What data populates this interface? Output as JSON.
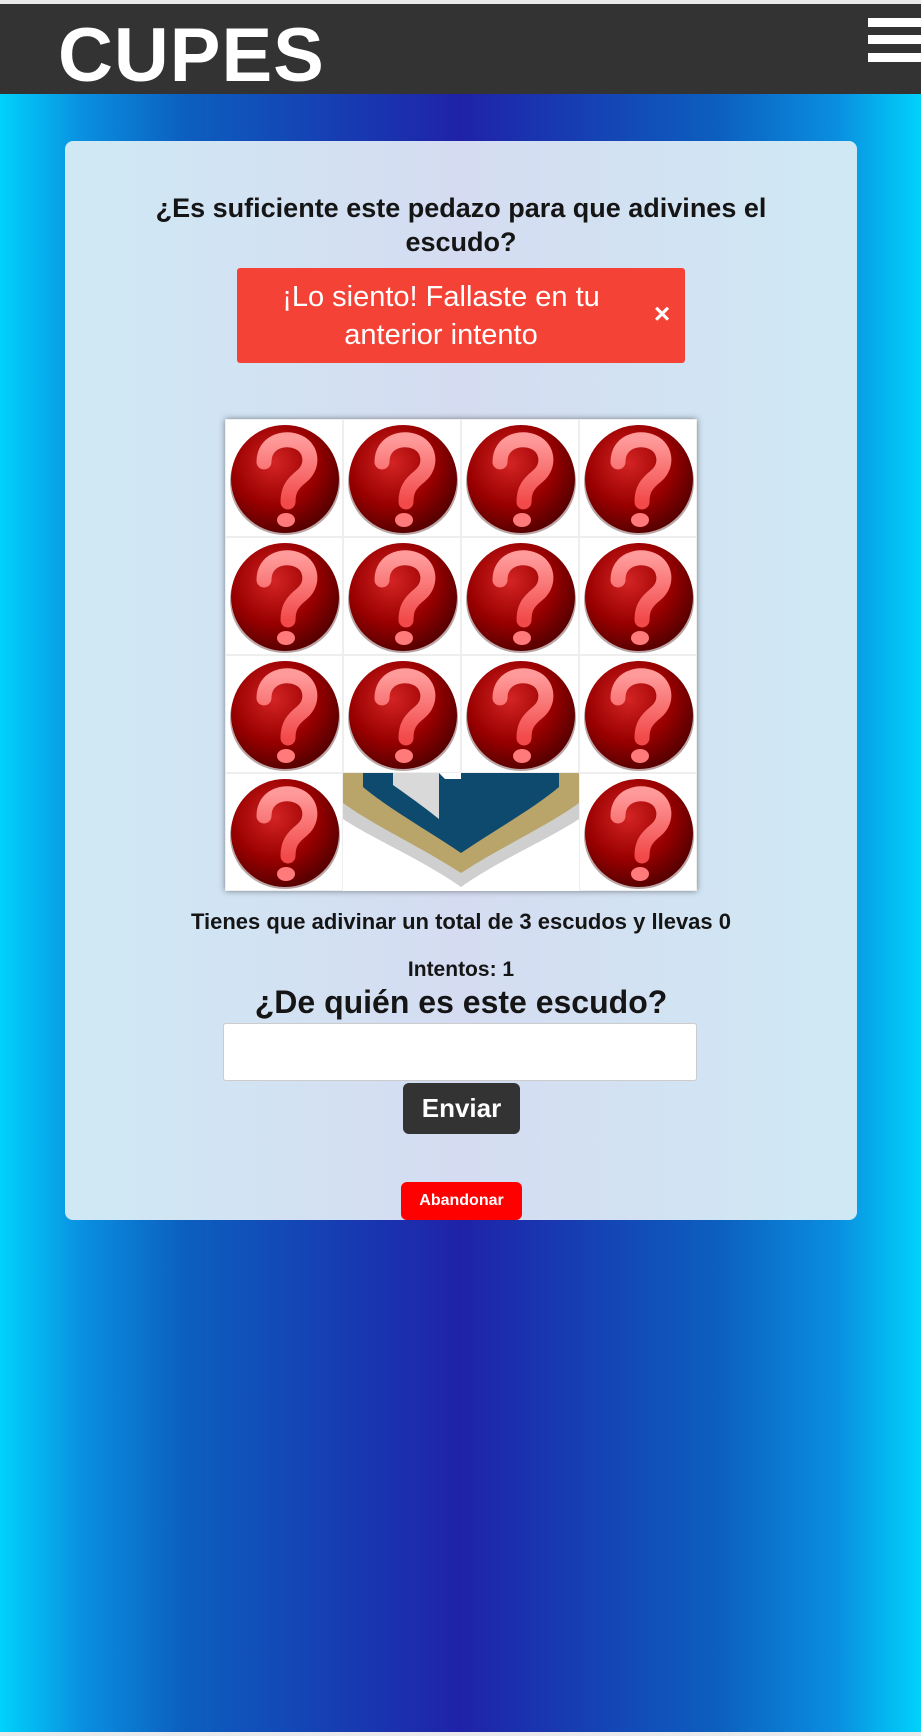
{
  "app": {
    "brand": "CUPES"
  },
  "nav": {
    "menu_icon": "hamburger-menu-icon"
  },
  "game": {
    "question": "¿Es suficiente este pedazo para que adivines el escudo?",
    "alert": {
      "message": "¡Lo siento! Fallaste en tu anterior intento",
      "close_label": "×"
    },
    "grid": {
      "rows": 4,
      "cols": 4,
      "hidden_tile_icon": "question-mark-icon",
      "revealed_tiles": [
        "4-2",
        "4-3"
      ]
    },
    "progress_text": "Tienes que adivinar un total de 3 escudos y llevas 0",
    "attempts_text": "Intentos: 1",
    "prompt": "¿De quién es este escudo?",
    "answer": {
      "value": "",
      "placeholder": ""
    },
    "submit_label": "Enviar",
    "abandon_label": "Abandonar"
  },
  "colors": {
    "navbar": "#333333",
    "alert": "#f44336",
    "abandon": "#ff0000",
    "card": "#d5e3f2"
  }
}
